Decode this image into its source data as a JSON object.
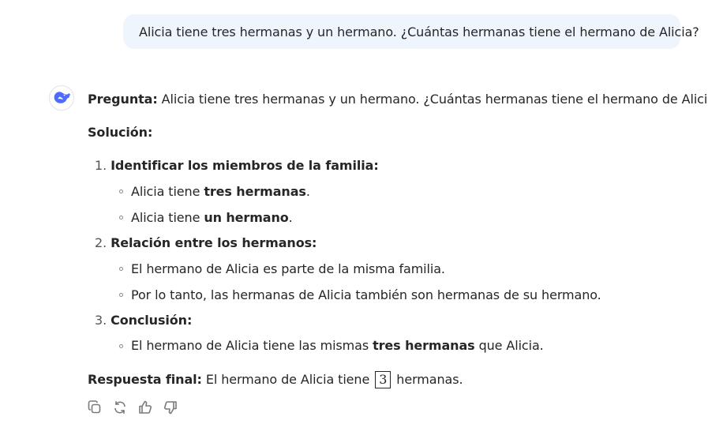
{
  "user_message": "Alicia tiene tres hermanas y un hermano. ¿Cuántas hermanas tiene el hermano de Alicia?",
  "answer": {
    "question_label": "Pregunta:",
    "question_text": "Alicia tiene tres hermanas y un hermano. ¿Cuántas hermanas tiene el hermano de Alicia?",
    "solution_label": "Solución:",
    "steps": [
      {
        "number": "1.",
        "title": "Identificar los miembros de la familia:",
        "bullets": [
          {
            "pre": "Alicia tiene ",
            "bold": "tres hermanas",
            "post": "."
          },
          {
            "pre": "Alicia tiene ",
            "bold": "un hermano",
            "post": "."
          }
        ]
      },
      {
        "number": "2.",
        "title": "Relación entre los hermanos:",
        "bullets": [
          {
            "text": "El hermano de Alicia es parte de la misma familia."
          },
          {
            "text": "Por lo tanto, las hermanas de Alicia también son hermanas de su hermano."
          }
        ]
      },
      {
        "number": "3.",
        "title": "Conclusión:",
        "bullets": [
          {
            "pre": "El hermano de Alicia tiene las mismas ",
            "bold": "tres hermanas",
            "post": " que Alicia."
          }
        ]
      }
    ],
    "final_label": "Respuesta final:",
    "final_pre": "El hermano de Alicia tiene",
    "final_value": "3",
    "final_post": "hermanas."
  },
  "actions": {
    "copy_icon": "copy-icon",
    "regenerate_icon": "regenerate-icon",
    "like_icon": "thumbs-up-icon",
    "dislike_icon": "thumbs-down-icon"
  },
  "colors": {
    "user_bubble_bg": "#eff5fc",
    "text": "#262626",
    "brand": "#4d6bfe",
    "icon_gray": "#8a8a8a"
  }
}
